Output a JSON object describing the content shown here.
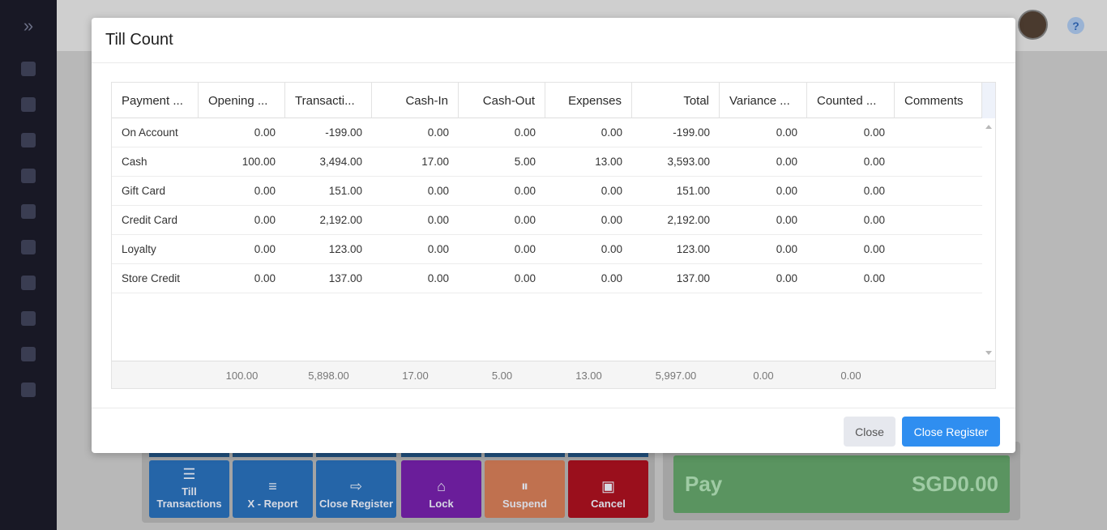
{
  "colors": {
    "sidebar": "#181825",
    "primary": "#2f8ef0",
    "tile_blue": "#2565a8",
    "tile_purple": "#6a1d9a",
    "tile_orange": "#c0714f",
    "tile_red": "#9a0f1c",
    "pay_green": "#5a9460"
  },
  "sidebar": {
    "expand_icon": "chevrons-right-icon",
    "items": [
      {
        "icon": "dashboard-icon"
      },
      {
        "icon": "bar-chart-icon"
      },
      {
        "icon": "cart-icon"
      },
      {
        "icon": "user-icon"
      },
      {
        "icon": "building-icon"
      },
      {
        "icon": "box-icon"
      },
      {
        "icon": "hierarchy-icon"
      },
      {
        "icon": "table-icon"
      },
      {
        "icon": "percent-icon"
      },
      {
        "icon": "toggle-icon"
      }
    ]
  },
  "header": {
    "help": "?"
  },
  "tiles": [
    {
      "label": "Till Transactions",
      "icon": "list-icon",
      "color": "#2565a8"
    },
    {
      "label": "X - Report",
      "icon": "report-icon",
      "color": "#2565a8"
    },
    {
      "label": "Close Register",
      "icon": "exit-icon",
      "color": "#2565a8"
    },
    {
      "label": "Lock",
      "icon": "lock-icon",
      "color": "#6a1d9a"
    },
    {
      "label": "Suspend",
      "icon": "pause-icon",
      "color": "#c0714f"
    },
    {
      "label": "Cancel",
      "icon": "stop-icon",
      "color": "#9a0f1c"
    }
  ],
  "pay": {
    "label": "Pay",
    "amount": "SGD0.00"
  },
  "modal": {
    "title": "Till Count",
    "columns": [
      "Payment ...",
      "Opening ...",
      "Transacti...",
      "Cash-In",
      "Cash-Out",
      "Expenses",
      "Total",
      "Variance ...",
      "Counted ...",
      "Comments"
    ],
    "rows": [
      [
        "On Account",
        "0.00",
        "-199.00",
        "0.00",
        "0.00",
        "0.00",
        "-199.00",
        "0.00",
        "0.00",
        ""
      ],
      [
        "Cash",
        "100.00",
        "3,494.00",
        "17.00",
        "5.00",
        "13.00",
        "3,593.00",
        "0.00",
        "0.00",
        ""
      ],
      [
        "Gift Card",
        "0.00",
        "151.00",
        "0.00",
        "0.00",
        "0.00",
        "151.00",
        "0.00",
        "0.00",
        ""
      ],
      [
        "Credit Card",
        "0.00",
        "2,192.00",
        "0.00",
        "0.00",
        "0.00",
        "2,192.00",
        "0.00",
        "0.00",
        ""
      ],
      [
        "Loyalty",
        "0.00",
        "123.00",
        "0.00",
        "0.00",
        "0.00",
        "123.00",
        "0.00",
        "0.00",
        ""
      ],
      [
        "Store Credit",
        "0.00",
        "137.00",
        "0.00",
        "0.00",
        "0.00",
        "137.00",
        "0.00",
        "0.00",
        ""
      ]
    ],
    "totals": [
      "",
      "100.00",
      "5,898.00",
      "17.00",
      "5.00",
      "13.00",
      "5,997.00",
      "0.00",
      "0.00",
      ""
    ],
    "buttons": {
      "close": "Close",
      "close_register": "Close Register"
    }
  }
}
